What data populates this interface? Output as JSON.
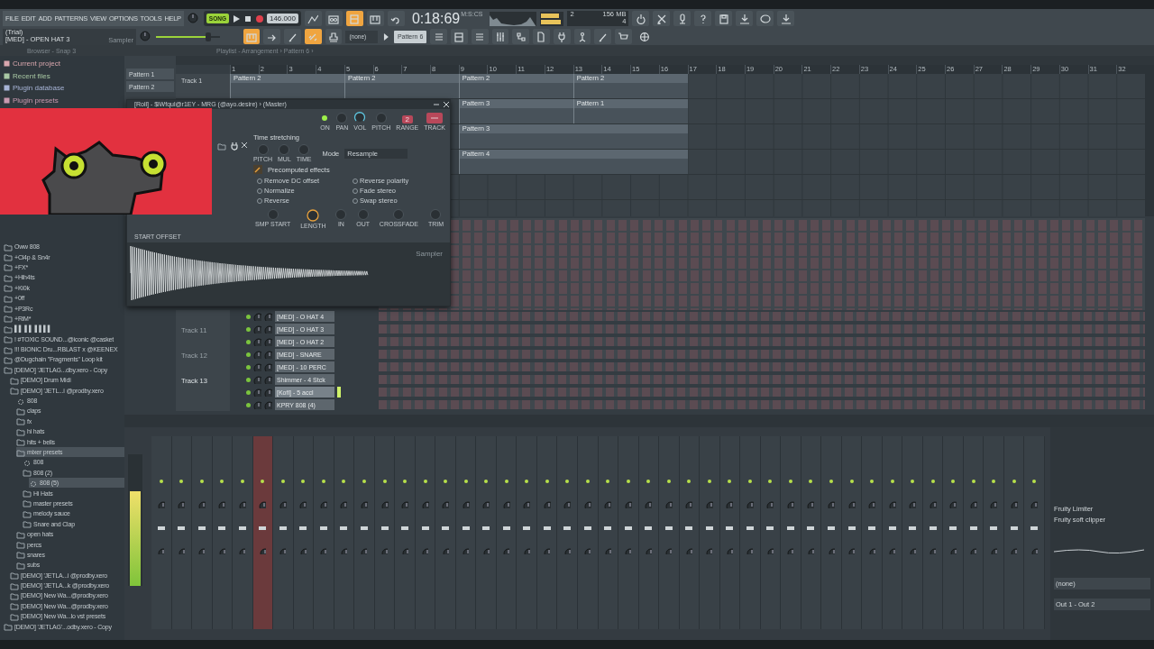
{
  "menu": [
    "FILE",
    "EDIT",
    "ADD",
    "PATTERNS",
    "VIEW",
    "OPTIONS",
    "TOOLS",
    "HELP"
  ],
  "hint": {
    "title": "(Trial)",
    "text": "[MED] - OPEN HAT 3",
    "plugin": "Sampler"
  },
  "transport": {
    "mode": "SONG",
    "tempo": "146.000"
  },
  "toggles_1": [
    {
      "on": false
    },
    {
      "on": false
    },
    {
      "on": true
    },
    {
      "on": false
    },
    {
      "on": false
    }
  ],
  "clock": {
    "time": "0:18:69",
    "unit": "M:S:CS"
  },
  "master_volume": {
    "level": 0.82
  },
  "cpu": {
    "cores": "2",
    "memory": "156 MB",
    "polyphony": "4"
  },
  "toggles_2": [
    {
      "on": true
    },
    {
      "on": false
    },
    {
      "on": false
    },
    {
      "on": true
    },
    {
      "on": false
    }
  ],
  "snap": {
    "value": "(none)"
  },
  "pattern": {
    "value": "Pattern 6"
  },
  "breadcrumbs": {
    "browser": "Browser - Snap 3",
    "playlist": "Playlist - Arrangement › Pattern 6 ›"
  },
  "browser": {
    "shortcuts": [
      {
        "label": "Current project",
        "color": "#d9a7ae"
      },
      {
        "label": "Recent files",
        "color": "#a9c9a4"
      },
      {
        "label": "Plugin database",
        "color": "#a7b4d6"
      },
      {
        "label": "Plugin presets",
        "color": "#c99ab0"
      }
    ],
    "tree": [
      {
        "label": "Oww 808",
        "selected": false
      },
      {
        "label": "+Cl4p & Sn4r",
        "selected": false
      },
      {
        "label": "+FX*",
        "selected": false
      },
      {
        "label": "+Hih4ts",
        "selected": false
      },
      {
        "label": "+Ki0k",
        "selected": false
      },
      {
        "label": "+0ff",
        "selected": false
      },
      {
        "label": "+P3Rc",
        "selected": false
      },
      {
        "label": "+RiM*",
        "selected": false
      },
      {
        "label": "▌▌ ▌▌ ▌▌▌▌",
        "selected": false
      },
      {
        "label": "! #TOXIC SOUND...@iconic @casket",
        "selected": false
      },
      {
        "label": "!!! BIONIC Dru...RBLAST x @KEENEX",
        "selected": false
      },
      {
        "label": "@Dugchain \"Fragments\" Loop kit",
        "selected": false
      },
      {
        "label": "[DEMO] 'JETLAG...dby.xero - Copy",
        "selected": false,
        "children": [
          {
            "label": "[DEMO] Drum Midi",
            "selected": false
          },
          {
            "label": "[DEMO] 'JETL...i @prodby.xero",
            "selected": false,
            "children": [
              {
                "label": "808",
                "selected": false
              },
              {
                "label": "claps",
                "selected": false
              },
              {
                "label": "fx",
                "selected": false
              },
              {
                "label": "hi hats",
                "selected": false
              },
              {
                "label": "hits + bells",
                "selected": false
              },
              {
                "label": "mixer presets",
                "selected": true,
                "children": [
                  {
                    "label": "808",
                    "selected": false
                  },
                  {
                    "label": "808 (2)",
                    "selected": false,
                    "children": [
                      {
                        "label": "808 (5)",
                        "selected": true
                      }
                    ]
                  },
                  {
                    "label": "Hi Hats",
                    "selected": false
                  },
                  {
                    "label": "master presets",
                    "selected": false
                  },
                  {
                    "label": "melody sauce",
                    "selected": false
                  },
                  {
                    "label": "Snare and Clap",
                    "selected": false
                  }
                ]
              },
              {
                "label": "open hats",
                "selected": false
              },
              {
                "label": "percs",
                "selected": false
              },
              {
                "label": "snares",
                "selected": false
              },
              {
                "label": "subs",
                "selected": false
              }
            ]
          },
          {
            "label": "[DEMO] 'JETLA...i @prodby.xero",
            "selected": false
          },
          {
            "label": "[DEMO] 'JETLA...k @prodby.xero",
            "selected": false
          },
          {
            "label": "[DEMO] New Wa...@prodby.xero",
            "selected": false
          },
          {
            "label": "[DEMO] New Wa...@prodby.xero",
            "selected": false
          },
          {
            "label": "[DEMO] New Wa...lo vst presets",
            "selected": false
          }
        ]
      },
      {
        "label": "[DEMO] 'JETLAG'...odby.xero - Copy",
        "selected": false
      }
    ]
  },
  "playlist": {
    "patterns": [
      {
        "label": "Pattern 1",
        "selected": false
      },
      {
        "label": "Pattern 2",
        "selected": false
      }
    ],
    "ruler": [
      "1",
      "2",
      "3",
      "4",
      "5",
      "6",
      "7",
      "8",
      "9",
      "10",
      "11",
      "12",
      "13",
      "14",
      "15",
      "16",
      "17",
      "18",
      "19",
      "20",
      "21",
      "22",
      "23",
      "24",
      "25",
      "26",
      "27",
      "28",
      "29",
      "30",
      "31",
      "32"
    ],
    "tracks": [
      {
        "name": "Track 1",
        "slots": [
          {
            "kind": "clip",
            "label": "Pattern 2"
          },
          {
            "kind": "clip",
            "label": "Pattern 2"
          },
          {
            "kind": "clip",
            "label": "Pattern 2"
          },
          {
            "kind": "clip",
            "label": "Pattern 2"
          }
        ]
      },
      {
        "slots": [
          {
            "kind": "empty"
          },
          {
            "kind": "empty"
          },
          {
            "kind": "clip",
            "label": "Pattern 3"
          },
          {
            "kind": "clip",
            "label": "Pattern 1"
          }
        ]
      },
      {
        "slots": [
          {
            "kind": "empty"
          },
          {
            "kind": "empty"
          },
          {
            "kind": "clip",
            "label": "Pattern 3"
          },
          {
            "kind": "continuation"
          }
        ]
      },
      {
        "slots": [
          {
            "kind": "empty"
          },
          {
            "kind": "empty"
          },
          {
            "kind": "clip",
            "label": "Pattern 4"
          },
          {
            "kind": "continuation"
          }
        ]
      },
      {
        "slots": [
          {
            "kind": "empty"
          },
          {
            "kind": "empty"
          },
          {
            "kind": "empty"
          },
          {
            "kind": "empty"
          }
        ]
      },
      {
        "slots": [
          {
            "kind": "empty"
          },
          {
            "kind": "empty"
          },
          {
            "kind": "empty"
          },
          {
            "kind": "empty"
          }
        ]
      }
    ]
  },
  "rack": {
    "track_labels": [
      {
        "label": "Track 11",
        "dimmed": true
      },
      {
        "label": "Track 12",
        "dimmed": true
      },
      {
        "label": "Track 13",
        "dimmed": false
      }
    ],
    "channels": [
      {
        "name": "[MED] - O HAT 4",
        "selected": false
      },
      {
        "name": "[MED] - O HAT 3",
        "selected": false
      },
      {
        "name": "[MED] - O HAT 2",
        "selected": false
      },
      {
        "name": "[MED] - SNARE",
        "selected": false
      },
      {
        "name": "[MED] - 10 PERC",
        "selected": false
      },
      {
        "name": "Shimmer - 4 Stck",
        "selected": false
      },
      {
        "name": "[Kofi] - 5 accl",
        "selected": true
      },
      {
        "name": "KPRY 808 (4)",
        "selected": false
      }
    ]
  },
  "mixer": {
    "master": {
      "level": 0.72
    },
    "strips": [
      {
        "selected": false
      },
      {
        "selected": false
      },
      {
        "selected": false
      },
      {
        "selected": false
      },
      {
        "selected": false
      },
      {
        "selected": true
      },
      {
        "selected": false
      },
      {
        "selected": false
      },
      {
        "selected": false
      },
      {
        "selected": false
      },
      {
        "selected": false
      },
      {
        "selected": false
      },
      {
        "selected": false
      },
      {
        "selected": false
      },
      {
        "selected": false
      },
      {
        "selected": false
      },
      {
        "selected": false
      },
      {
        "selected": false
      },
      {
        "selected": false
      },
      {
        "selected": false
      },
      {
        "selected": false
      },
      {
        "selected": false
      },
      {
        "selected": false
      },
      {
        "selected": false
      },
      {
        "selected": false
      },
      {
        "selected": false
      },
      {
        "selected": false
      },
      {
        "selected": false
      },
      {
        "selected": false
      },
      {
        "selected": false
      },
      {
        "selected": false
      },
      {
        "selected": false
      },
      {
        "selected": false
      },
      {
        "selected": false
      },
      {
        "selected": false
      },
      {
        "selected": false
      },
      {
        "selected": false
      },
      {
        "selected": false
      },
      {
        "selected": false
      },
      {
        "selected": false
      },
      {
        "selected": false
      },
      {
        "selected": false
      },
      {
        "selected": false
      },
      {
        "selected": false
      }
    ],
    "effects": [
      "Fruity Limiter",
      "Fruity soft clipper"
    ],
    "input": "(none)",
    "output": "Out 1 - Out 2"
  },
  "sampler": {
    "title": "[Roll] - $iWfqul@r1EY - MRG (@ayo.desire) › (Master)",
    "header_controls": [
      {
        "kind": "led",
        "label": "ON"
      },
      {
        "kind": "knob",
        "label": "PAN"
      },
      {
        "kind": "volume",
        "label": "VOL"
      },
      {
        "kind": "knob",
        "label": "PITCH"
      },
      {
        "kind": "range",
        "label": "RANGE",
        "value": "2"
      },
      {
        "kind": "track",
        "label": "TRACK"
      }
    ],
    "stretch_title": "Time stretching",
    "stretch_knobs": [
      "PITCH",
      "MUL",
      "TIME"
    ],
    "mode_label": "Mode",
    "mode_value": "Resample",
    "effects_title": "Precomputed effects",
    "effects": [
      {
        "label": "Remove DC offset",
        "checked": false
      },
      {
        "label": "Reverse polarity",
        "checked": false
      },
      {
        "label": "Normalize",
        "checked": false
      },
      {
        "label": "Fade stereo",
        "checked": false
      },
      {
        "label": "Reverse",
        "checked": false
      },
      {
        "label": "Swap stereo",
        "checked": false
      }
    ],
    "bottom_knobs": [
      {
        "kind": "knob",
        "label": "SMP START"
      },
      {
        "kind": "ring",
        "label": "LENGTH"
      },
      {
        "kind": "knob",
        "label": "IN"
      },
      {
        "kind": "knob",
        "label": "OUT"
      },
      {
        "kind": "knob",
        "label": "CROSSFADE"
      },
      {
        "kind": "knob",
        "label": "TRIM"
      }
    ],
    "offset_label": "START OFFSET",
    "watermark": "Sampler"
  }
}
